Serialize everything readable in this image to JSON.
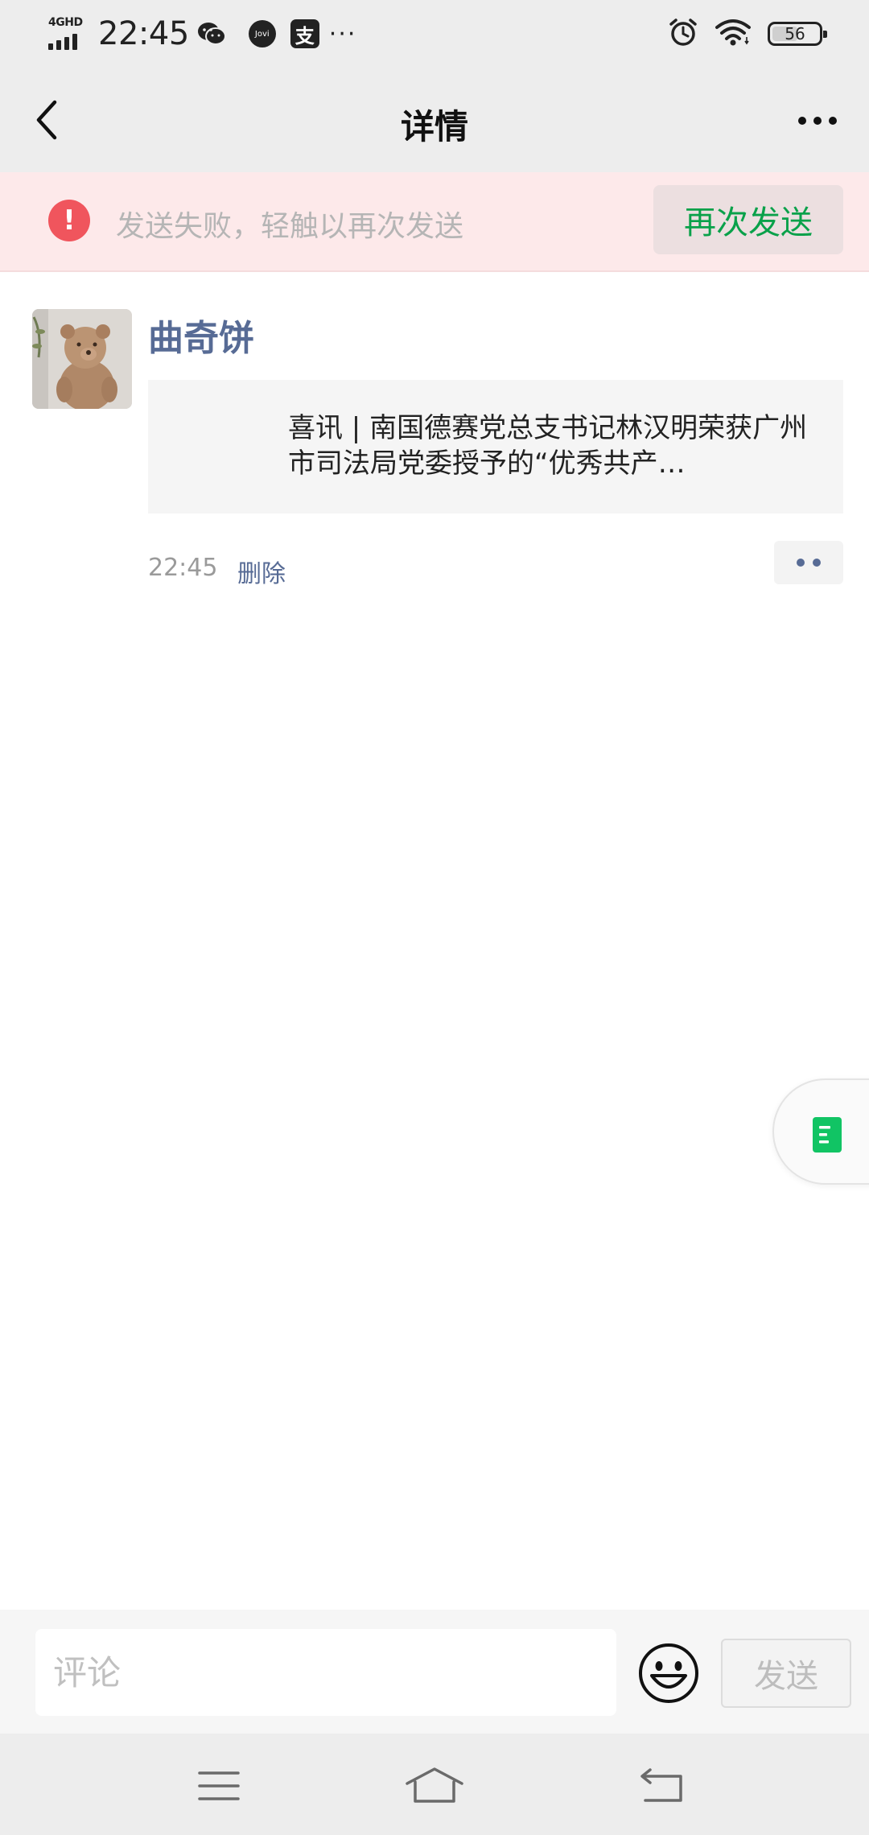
{
  "status_bar": {
    "network": "4GHD",
    "time": "22:45",
    "jovi_label": "Jovi",
    "alipay_label": "支",
    "more": "···",
    "battery": "56",
    "battery_level": 0.56
  },
  "nav": {
    "title": "详情"
  },
  "banner": {
    "message": "发送失败，轻触以再次发送",
    "retry_label": "再次发送",
    "icon_glyph": "!"
  },
  "post": {
    "username": "曲奇饼",
    "link_title": "喜讯 | 南国德赛党总支书记林汉明荣获广州市司法局党委授予的“优秀共产…",
    "time": "22:45",
    "delete_label": "删除"
  },
  "comment": {
    "placeholder": "评论",
    "send_label": "发送"
  },
  "colors": {
    "link_blue": "#576b95",
    "error_red": "#f0555d",
    "success_green": "#0aa14a",
    "banner_bg": "#fde9ea",
    "floating_icon_green": "#11c464"
  },
  "icons": {
    "back": "chevron-left-icon",
    "more": "more-horizontal-icon",
    "error": "exclamation-circle-icon",
    "emoji": "smiley-icon",
    "floating": "document-icon",
    "alarm": "alarm-clock-icon",
    "wifi": "wifi-icon",
    "menu": "menu-icon",
    "home": "home-icon",
    "back_key": "return-icon"
  }
}
